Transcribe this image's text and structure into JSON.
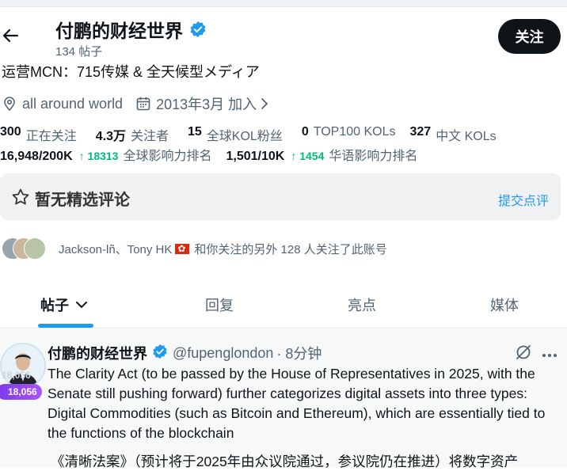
{
  "profile": {
    "name": "付鹏的财经世界",
    "post_count": "134 帖子",
    "follow_label": "关注",
    "bio": "运营MCN：715传媒 & 全天候型メディア",
    "location": "all around world",
    "joined": "2013年3月 加入"
  },
  "stats_row1": [
    {
      "value": "300",
      "label": "正在关注"
    },
    {
      "value": "4.3万",
      "label": "关注者"
    },
    {
      "value": "15",
      "label": "全球KOL粉丝"
    },
    {
      "value": "0",
      "label": "TOP100 KOLs"
    },
    {
      "value": "327",
      "label": "中文 KOLs"
    }
  ],
  "stats_row2": [
    {
      "value": "16,948/200K",
      "change": "↑ 18313",
      "label": "全球影响力排名"
    },
    {
      "value": "1,501/10K",
      "change": "↑ 1454",
      "label": "华语影响力排名"
    }
  ],
  "review": {
    "title": "暂无精选评论",
    "submit_label": "提交点评"
  },
  "followed_by": {
    "names": "Jackson-lñ、Tony HK",
    "suffix": "和你关注的另外 128 人关注了此账号"
  },
  "tabs": [
    {
      "label": "帖子"
    },
    {
      "label": "回复"
    },
    {
      "label": "亮点"
    },
    {
      "label": "媒体"
    }
  ],
  "post": {
    "author": "付鹏的财经世界",
    "handle": "@fupenglondon",
    "time": "· 8分钟",
    "badge": "18,056",
    "text_en": "The Clarity Act (to be passed by the House of Representatives in 2025, with the Senate still pushing forward) further categorizes digital assets into three types: Digital Commodities (such as Bitcoin and Ethereum), which are essentially tied to the functions of the blockchain",
    "text_zh": "《清晰法案》（预计将于2025年由众议院通过，参议院仍在推进）将数字资产"
  },
  "colors": {
    "accent": "#1d9bf0",
    "positive": "#00ba7c",
    "follow_button": "#0f1419"
  },
  "icons": [
    "back-arrow-icon",
    "verified-badge-icon",
    "location-pin-icon",
    "calendar-icon",
    "chevron-right-icon",
    "star-icon",
    "chevron-down-icon",
    "translate-off-icon",
    "more-icon"
  ]
}
